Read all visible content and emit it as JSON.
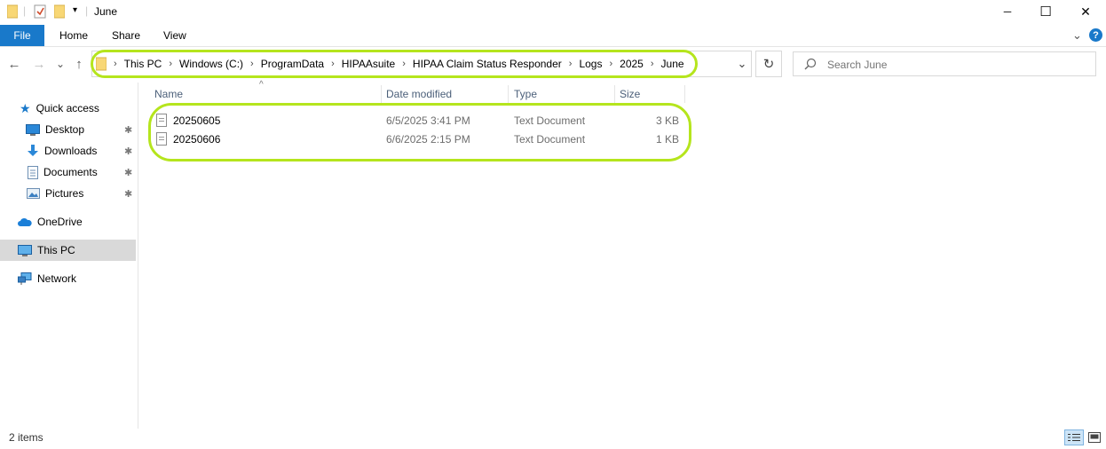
{
  "window": {
    "title": "June",
    "minimize_glyph": "─",
    "maximize_glyph": "☐",
    "close_glyph": "✕"
  },
  "ribbon": {
    "tabs": [
      "File",
      "Home",
      "Share",
      "View"
    ],
    "help_glyph": "?",
    "expand_glyph": "⌄"
  },
  "address": {
    "breadcrumbs": [
      "This PC",
      "Windows (C:)",
      "ProgramData",
      "HIPAAsuite",
      "HIPAA Claim Status Responder",
      "Logs",
      "2025",
      "June"
    ],
    "separator": "›",
    "dropdown_glyph": "⌄",
    "refresh_glyph": "↻"
  },
  "nav_buttons": {
    "back": "←",
    "forward": "→",
    "recent": "⌄",
    "up": "↑"
  },
  "search": {
    "placeholder": "Search June"
  },
  "nav_pane": {
    "quick_access": "Quick access",
    "items": [
      {
        "label": "Desktop",
        "pinned": true
      },
      {
        "label": "Downloads",
        "pinned": true
      },
      {
        "label": "Documents",
        "pinned": true
      },
      {
        "label": "Pictures",
        "pinned": true
      }
    ],
    "onedrive": "OneDrive",
    "this_pc": "This PC",
    "network": "Network",
    "pin_glyph": "📌"
  },
  "file_list": {
    "columns": [
      "Name",
      "Date modified",
      "Type",
      "Size"
    ],
    "sort_glyph": "^",
    "rows": [
      {
        "name": "20250605",
        "date": "6/5/2025 3:41 PM",
        "type": "Text Document",
        "size": "3 KB"
      },
      {
        "name": "20250606",
        "date": "6/6/2025 2:15 PM",
        "type": "Text Document",
        "size": "1 KB"
      }
    ]
  },
  "status_bar": {
    "count": "2 items"
  },
  "colors": {
    "accent": "#1979ca",
    "highlight": "#b5e51d",
    "folder": "#f8d775"
  }
}
